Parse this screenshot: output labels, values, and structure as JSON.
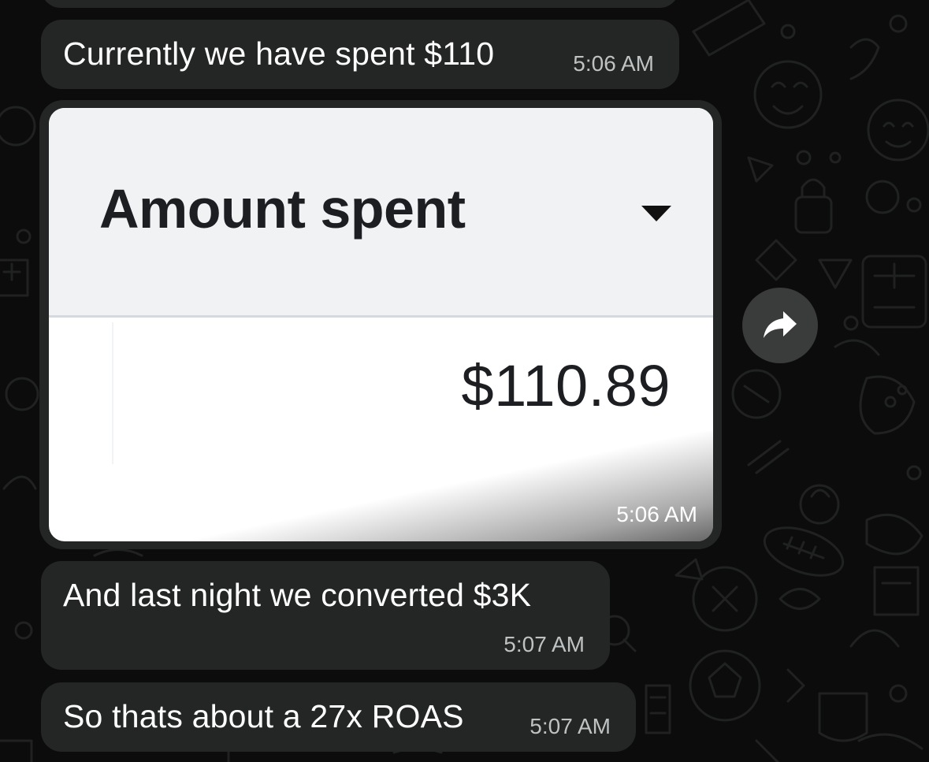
{
  "messages": [
    {
      "text": "Currently we have spent $110",
      "time": "5:06 AM"
    },
    {
      "type": "image",
      "image": {
        "header_label": "Amount spent",
        "value": "$110.89"
      },
      "time": "5:06 AM"
    },
    {
      "text": "And last night we converted $3K",
      "time": "5:07 AM"
    },
    {
      "text": "So thats about a 27x ROAS",
      "time": "5:07 AM"
    }
  ],
  "icons": {
    "forward": "forward-arrow-icon",
    "dropdown": "caret-down-icon"
  },
  "colors": {
    "background": "#0c0c0c",
    "bubble": "#242626",
    "text": "#ffffff",
    "timestamp": "#bfc2c2",
    "forward_button": "#3a3c3c"
  }
}
